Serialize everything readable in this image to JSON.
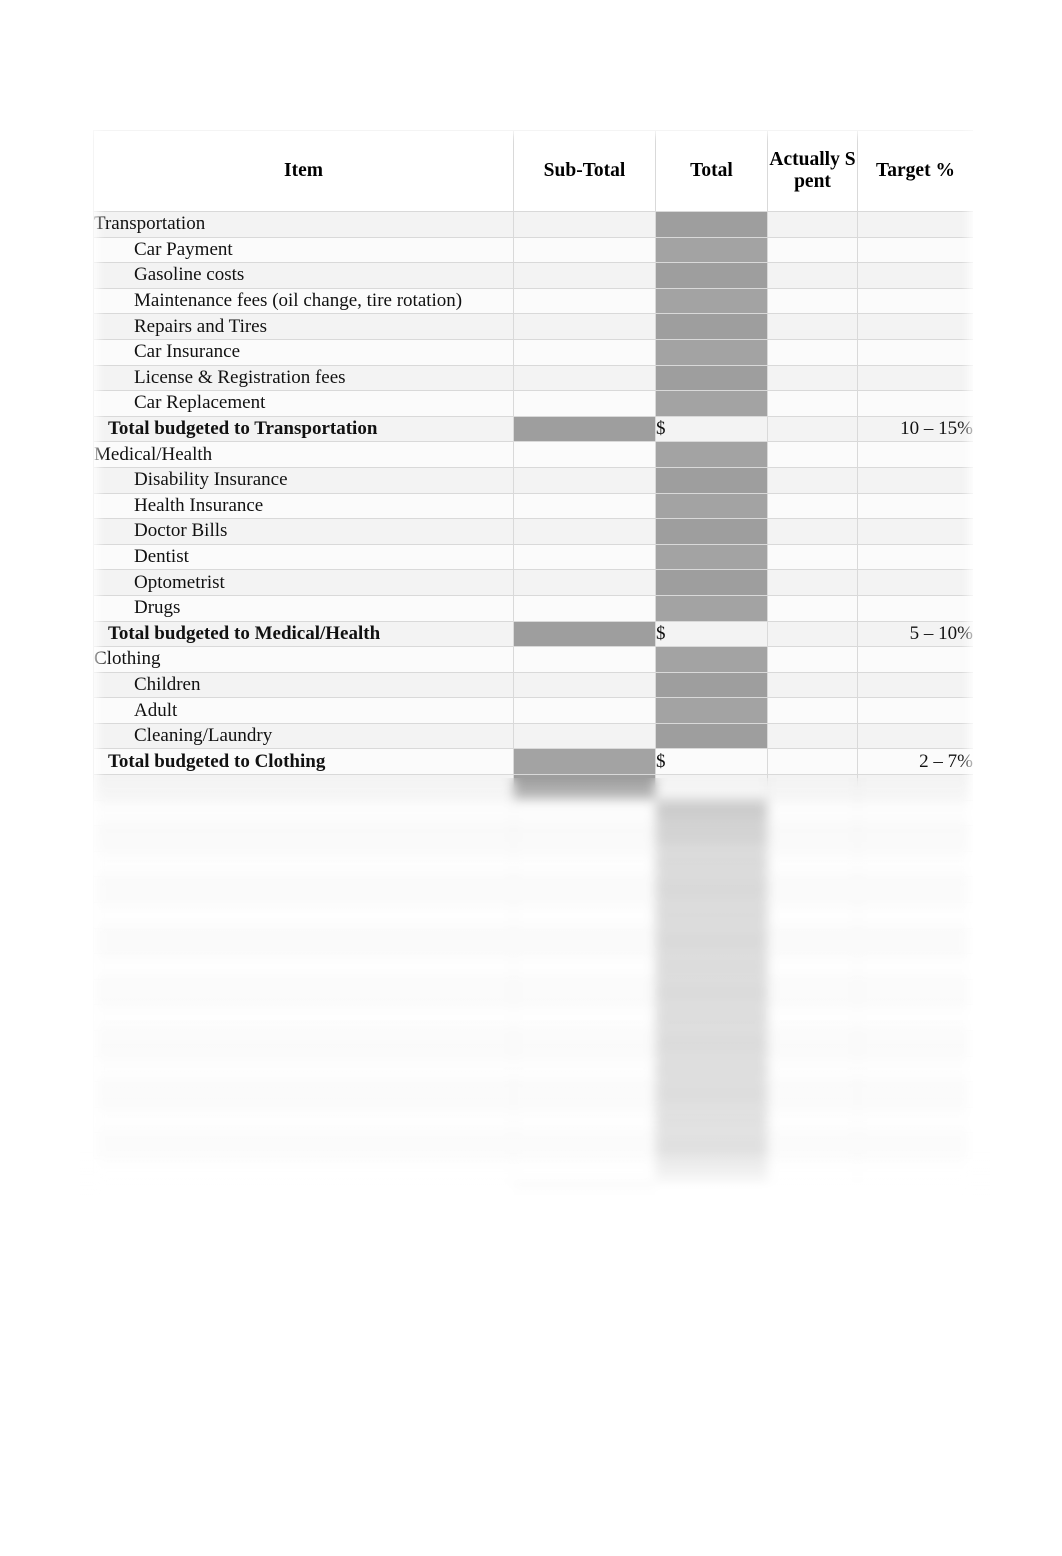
{
  "table": {
    "columns": [
      {
        "key": "item",
        "label": "Item"
      },
      {
        "key": "sub",
        "label": "Sub-Total"
      },
      {
        "key": "total",
        "label": "Total"
      },
      {
        "key": "actual",
        "label": "Actually Spent"
      },
      {
        "key": "target",
        "label": "Target %"
      }
    ],
    "header": {
      "item": "Item",
      "sub_total": "Sub-Total",
      "total": "Total",
      "actually_spent": "Actually Spent",
      "target_pct": "Target %"
    },
    "currency_symbol": "$",
    "rows": [
      {
        "label": "Transportation",
        "kind": "section"
      },
      {
        "label": "Car Payment",
        "kind": "detail"
      },
      {
        "label": "Gasoline costs",
        "kind": "detail"
      },
      {
        "label": "Maintenance fees (oil change, tire rotation)",
        "kind": "detail"
      },
      {
        "label": "Repairs and Tires",
        "kind": "detail"
      },
      {
        "label": "Car Insurance",
        "kind": "detail"
      },
      {
        "label": "License & Registration fees",
        "kind": "detail"
      },
      {
        "label": "Car Replacement",
        "kind": "detail"
      },
      {
        "label": "Total budgeted to Transportation",
        "kind": "total",
        "total": "$",
        "target": "10 – 15%"
      },
      {
        "label": "Medical/Health",
        "kind": "section"
      },
      {
        "label": "Disability Insurance",
        "kind": "detail"
      },
      {
        "label": "Health Insurance",
        "kind": "detail"
      },
      {
        "label": "Doctor Bills",
        "kind": "detail"
      },
      {
        "label": "Dentist",
        "kind": "detail"
      },
      {
        "label": "Optometrist",
        "kind": "detail"
      },
      {
        "label": "Drugs",
        "kind": "detail"
      },
      {
        "label": "Total budgeted to Medical/Health",
        "kind": "total",
        "total": "$",
        "target": "5 – 10%"
      },
      {
        "label": "Clothing",
        "kind": "section"
      },
      {
        "label": "Children",
        "kind": "detail"
      },
      {
        "label": "Adult",
        "kind": "detail"
      },
      {
        "label": "Cleaning/Laundry",
        "kind": "detail"
      },
      {
        "label": "Total budgeted to Clothing",
        "kind": "total",
        "total": "$",
        "target": "2 – 7%"
      },
      {
        "label": "",
        "kind": "total_obscured",
        "total": "",
        "target": ""
      },
      {
        "label": "",
        "kind": "section_obscured"
      },
      {
        "label": "",
        "kind": "detail_obscured"
      },
      {
        "label": "",
        "kind": "detail_obscured"
      },
      {
        "label": "",
        "kind": "detail_obscured"
      },
      {
        "label": "",
        "kind": "detail_obscured"
      },
      {
        "label": "",
        "kind": "detail_obscured"
      },
      {
        "label": "",
        "kind": "detail_obscured"
      },
      {
        "label": "",
        "kind": "detail_obscured"
      },
      {
        "label": "",
        "kind": "detail_obscured"
      },
      {
        "label": "",
        "kind": "detail_obscured"
      },
      {
        "label": "",
        "kind": "detail_obscured"
      },
      {
        "label": "",
        "kind": "detail_obscured"
      },
      {
        "label": "",
        "kind": "detail_obscured"
      },
      {
        "label": "",
        "kind": "detail_obscured"
      },
      {
        "label": "",
        "kind": "detail_obscured"
      },
      {
        "label": "",
        "kind": "total_obscured",
        "total": "",
        "target": ""
      }
    ]
  },
  "colors": {
    "page_background": "#ffffff",
    "cell_background": "#fbfbfb",
    "cell_background_alt": "#f3f3f3",
    "shaded_cell": "#a3a3a3",
    "grid_line": "#d9d9d9",
    "text": "#111111"
  }
}
